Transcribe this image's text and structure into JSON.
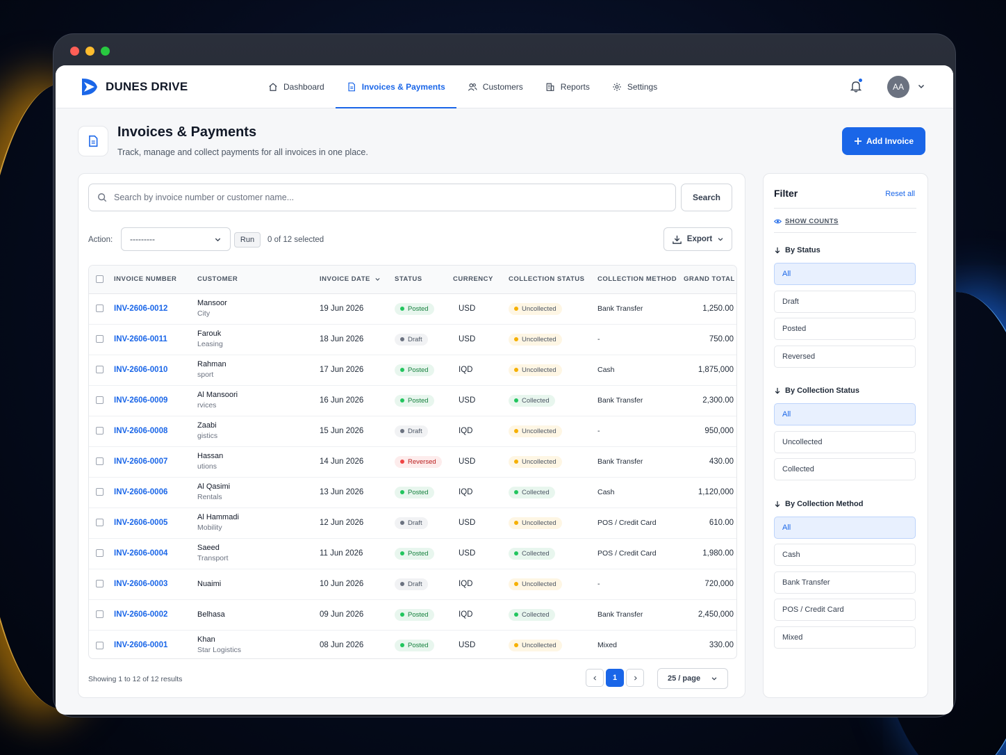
{
  "brand": {
    "name": "DUNES DRIVE"
  },
  "nav": {
    "items": [
      {
        "label": "Dashboard",
        "icon": "home-icon"
      },
      {
        "label": "Invoices & Payments",
        "icon": "document-icon"
      },
      {
        "label": "Customers",
        "icon": "users-icon"
      },
      {
        "label": "Reports",
        "icon": "building-icon"
      },
      {
        "label": "Settings",
        "icon": "gear-icon"
      }
    ],
    "active": "Invoices & Payments"
  },
  "user": {
    "initials": "AA"
  },
  "page": {
    "title": "Invoices & Payments",
    "subtitle": "Track, manage and collect payments for all invoices in one place.",
    "add_button": "Add Invoice"
  },
  "search": {
    "placeholder": "Search by invoice number or customer name...",
    "button": "Search"
  },
  "actions": {
    "label": "Action:",
    "select_value": "---------",
    "run": "Run",
    "selected": "0 of 12 selected",
    "export": "Export"
  },
  "table": {
    "columns": [
      "Invoice Number",
      "Customer",
      "Invoice Date",
      "Status",
      "Currency",
      "Collection Status",
      "Collection Method",
      "Grand Total"
    ],
    "rows": [
      {
        "invoice": "INV-2606-0012",
        "name": "Mansoor",
        "company": "City",
        "date": "19 Jun 2026",
        "status": "Posted",
        "currency": "USD",
        "collection": "Uncollected",
        "method": "Bank Transfer",
        "total": "1,250.00"
      },
      {
        "invoice": "INV-2606-0011",
        "name": "Farouk",
        "company": "Leasing",
        "date": "18 Jun 2026",
        "status": "Draft",
        "currency": "USD",
        "collection": "Uncollected",
        "method": "-",
        "total": "750.00"
      },
      {
        "invoice": "INV-2606-0010",
        "name": "Rahman",
        "company": "sport",
        "date": "17 Jun 2026",
        "status": "Posted",
        "currency": "IQD",
        "collection": "Uncollected",
        "method": "Cash",
        "total": "1,875,000"
      },
      {
        "invoice": "INV-2606-0009",
        "name": "Al Mansoori",
        "company": "rvices",
        "date": "16 Jun 2026",
        "status": "Posted",
        "currency": "USD",
        "collection": "Collected",
        "method": "Bank Transfer",
        "total": "2,300.00"
      },
      {
        "invoice": "INV-2606-0008",
        "name": "Zaabi",
        "company": "gistics",
        "date": "15 Jun 2026",
        "status": "Draft",
        "currency": "IQD",
        "collection": "Uncollected",
        "method": "-",
        "total": "950,000"
      },
      {
        "invoice": "INV-2606-0007",
        "name": "Hassan",
        "company": "utions",
        "date": "14 Jun 2026",
        "status": "Reversed",
        "currency": "USD",
        "collection": "Uncollected",
        "method": "Bank Transfer",
        "total": "430.00"
      },
      {
        "invoice": "INV-2606-0006",
        "name": "Al Qasimi",
        "company": "Rentals",
        "date": "13 Jun 2026",
        "status": "Posted",
        "currency": "IQD",
        "collection": "Collected",
        "method": "Cash",
        "total": "1,120,000"
      },
      {
        "invoice": "INV-2606-0005",
        "name": "Al Hammadi",
        "company": "Mobility",
        "date": "12 Jun 2026",
        "status": "Draft",
        "currency": "USD",
        "collection": "Uncollected",
        "method": "POS / Credit Card",
        "total": "610.00"
      },
      {
        "invoice": "INV-2606-0004",
        "name": "Saeed",
        "company": "Transport",
        "date": "11 Jun 2026",
        "status": "Posted",
        "currency": "USD",
        "collection": "Collected",
        "method": "POS / Credit Card",
        "total": "1,980.00"
      },
      {
        "invoice": "INV-2606-0003",
        "name": "Nuaimi",
        "company": "",
        "date": "10 Jun 2026",
        "status": "Draft",
        "currency": "IQD",
        "collection": "Uncollected",
        "method": "-",
        "total": "720,000"
      },
      {
        "invoice": "INV-2606-0002",
        "name": "Belhasa",
        "company": "",
        "date": "09 Jun 2026",
        "status": "Posted",
        "currency": "IQD",
        "collection": "Collected",
        "method": "Bank Transfer",
        "total": "2,450,000"
      },
      {
        "invoice": "INV-2606-0001",
        "name": "Khan",
        "company": "Star Logistics",
        "date": "08 Jun 2026",
        "status": "Posted",
        "currency": "USD",
        "collection": "Uncollected",
        "method": "Mixed",
        "total": "330.00"
      }
    ]
  },
  "footer": {
    "showing": "Showing 1 to 12 of 12 results",
    "page": "1",
    "per_page": "25 / page"
  },
  "filter": {
    "title": "Filter",
    "reset": "Reset all",
    "show_counts": "SHOW COUNTS",
    "groups": [
      {
        "title": "By Status",
        "options": [
          "All",
          "Draft",
          "Posted",
          "Reversed"
        ]
      },
      {
        "title": "By Collection Status",
        "options": [
          "All",
          "Uncollected",
          "Collected"
        ]
      },
      {
        "title": "By Collection Method",
        "options": [
          "All",
          "Cash",
          "Bank Transfer",
          "POS / Credit Card",
          "Mixed"
        ]
      }
    ]
  },
  "colors": {
    "accent": "#1a66e8",
    "posted": "#22c55e",
    "reversed": "#ef4444",
    "uncollected": "#f5b000"
  }
}
